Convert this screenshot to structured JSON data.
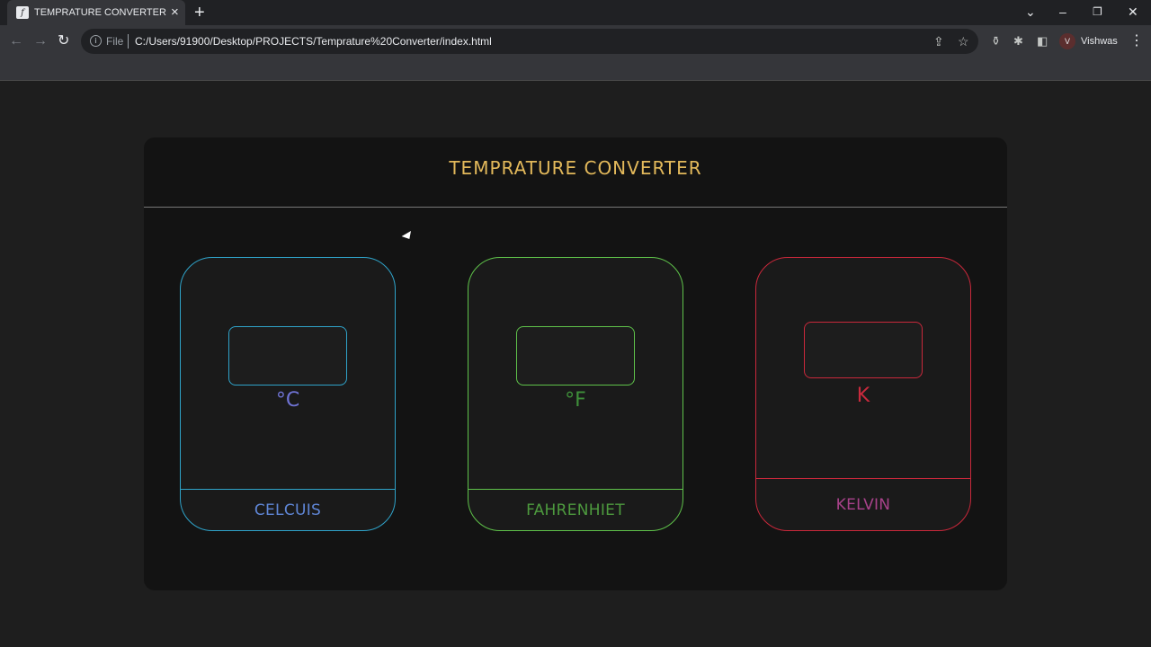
{
  "browser": {
    "tab": {
      "title": "TEMPRATURE CONVERTER"
    },
    "omnibox": {
      "scheme_label": "File",
      "url": "C:/Users/91900/Desktop/PROJECTS/Temprature%20Converter/index.html"
    },
    "profile": {
      "initial": "V",
      "name": "Vishwas"
    }
  },
  "page": {
    "title": "TEMPRATURE CONVERTER",
    "panels": [
      {
        "name": "CELCUIS",
        "unit": "°C",
        "input_value": "",
        "border_color": "#2fa3c9",
        "unit_color": "#6f73d4",
        "name_color": "#5f86d6"
      },
      {
        "name": "FAHRENHIET",
        "unit": "°F",
        "input_value": "",
        "border_color": "#5fc24a",
        "unit_color": "#3f8f3a",
        "name_color": "#4d9a3e"
      },
      {
        "name": "KELVIN",
        "unit": "K",
        "input_value": "",
        "border_color": "#c9283b",
        "unit_color": "#c92a3d",
        "name_color": "#a8428a"
      }
    ]
  }
}
